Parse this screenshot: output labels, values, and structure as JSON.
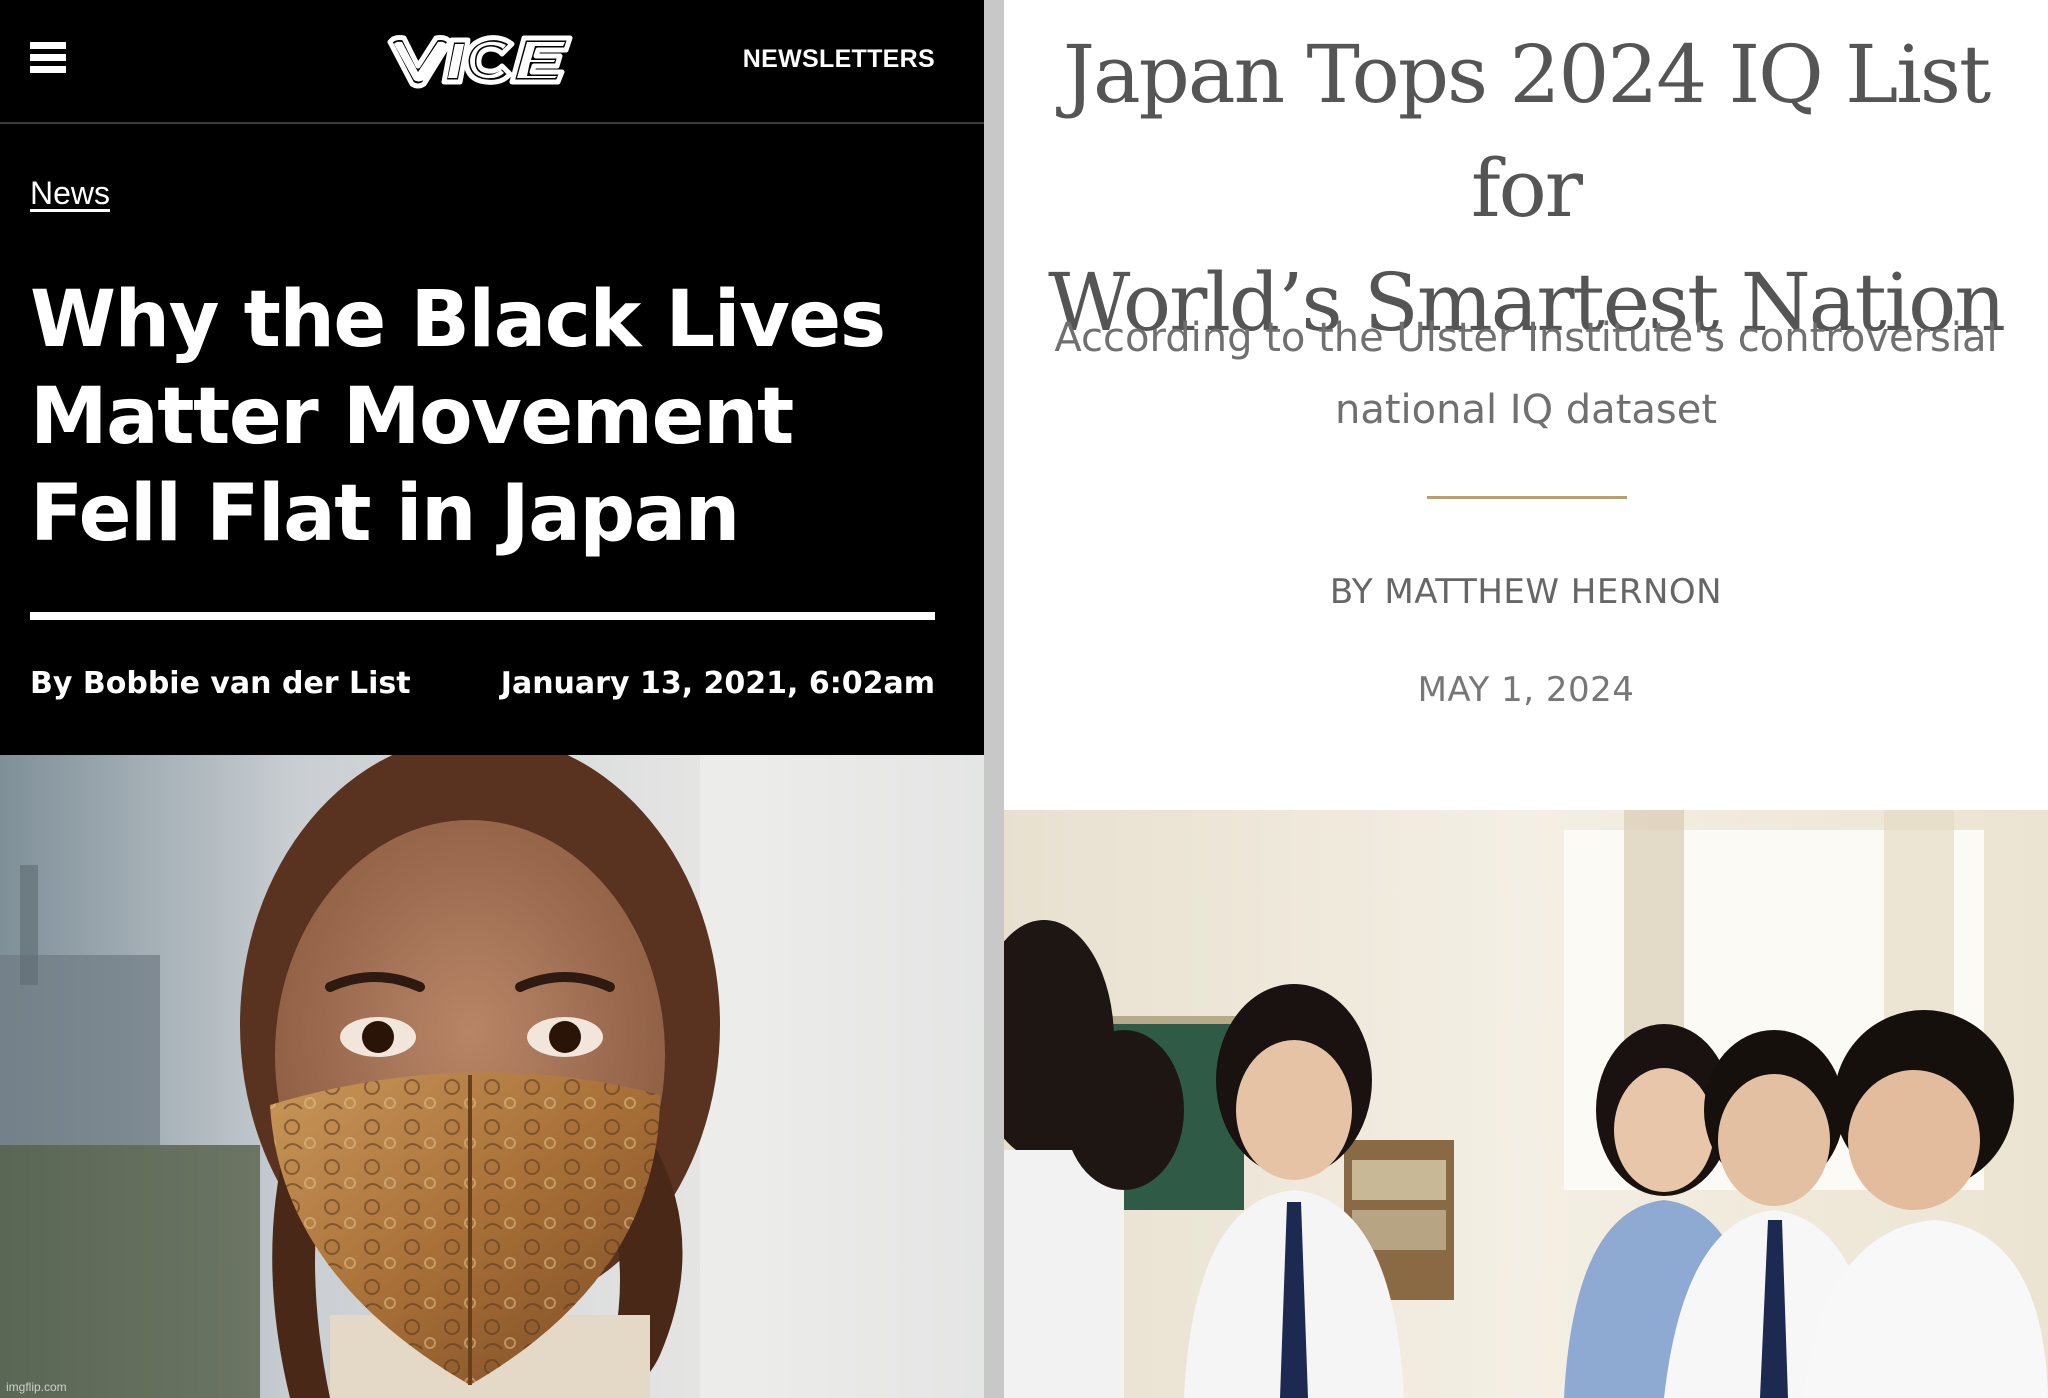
{
  "left_article": {
    "site_logo_text": "VICE",
    "nav": {
      "menu_icon": "hamburger-menu-icon",
      "newsletters_label": "NEWSLETTERS"
    },
    "category": "News",
    "headline_lines": [
      "Why the Black Lives",
      "Matter Movement",
      "Fell Flat in Japan"
    ],
    "byline": "By Bobbie van der List",
    "dateline": "January 13, 2021, 6:02am",
    "watermark": "imgflip.com"
  },
  "right_article": {
    "title_lines": [
      "Japan Tops 2024 IQ List for",
      "World’s Smartest Nation"
    ],
    "subhead_lines": [
      "According to the Ulster Institute's controversial",
      "national IQ dataset"
    ],
    "byline": "BY MATTHEW HERNON",
    "dateline": "MAY 1, 2024"
  },
  "colors": {
    "left_background": "#000000",
    "left_text": "#ffffff",
    "right_background": "#ffffff",
    "right_title": "#555555",
    "accent_rule": "#b89f6e",
    "panel_gap": "#c8c8c8"
  }
}
